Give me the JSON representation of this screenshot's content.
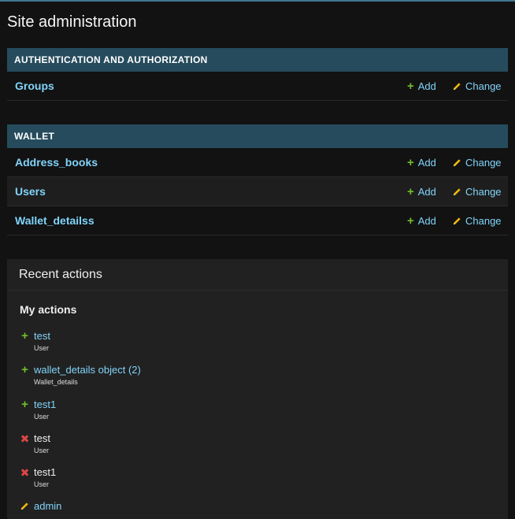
{
  "page": {
    "title": "Site administration"
  },
  "modules": [
    {
      "caption": "AUTHENTICATION AND AUTHORIZATION",
      "models": [
        {
          "name": "Groups",
          "add_label": "Add",
          "change_label": "Change"
        }
      ]
    },
    {
      "caption": "WALLET",
      "models": [
        {
          "name": "Address_books",
          "add_label": "Add",
          "change_label": "Change"
        },
        {
          "name": "Users",
          "add_label": "Add",
          "change_label": "Change"
        },
        {
          "name": "Wallet_detailss",
          "add_label": "Add",
          "change_label": "Change"
        }
      ]
    }
  ],
  "recent_actions": {
    "title": "Recent actions",
    "subtitle": "My actions",
    "items": [
      {
        "kind": "add",
        "icon": "plus-icon",
        "object": "test",
        "type": "User"
      },
      {
        "kind": "add",
        "icon": "plus-icon",
        "object": "wallet_details object (2)",
        "type": "Wallet_details"
      },
      {
        "kind": "add",
        "icon": "plus-icon",
        "object": "test1",
        "type": "User"
      },
      {
        "kind": "delete",
        "icon": "x-icon",
        "object": "test",
        "type": "User"
      },
      {
        "kind": "delete",
        "icon": "x-icon",
        "object": "test1",
        "type": "User"
      },
      {
        "kind": "change",
        "icon": "pencil-icon",
        "object": "admin",
        "type": ""
      }
    ]
  },
  "colors": {
    "background": "#121212",
    "module_header": "#264b5d",
    "link": "#81d4fa",
    "add_green": "#70bf2b",
    "delete_red": "#dd4646",
    "change_yellow": "#efb80b"
  }
}
